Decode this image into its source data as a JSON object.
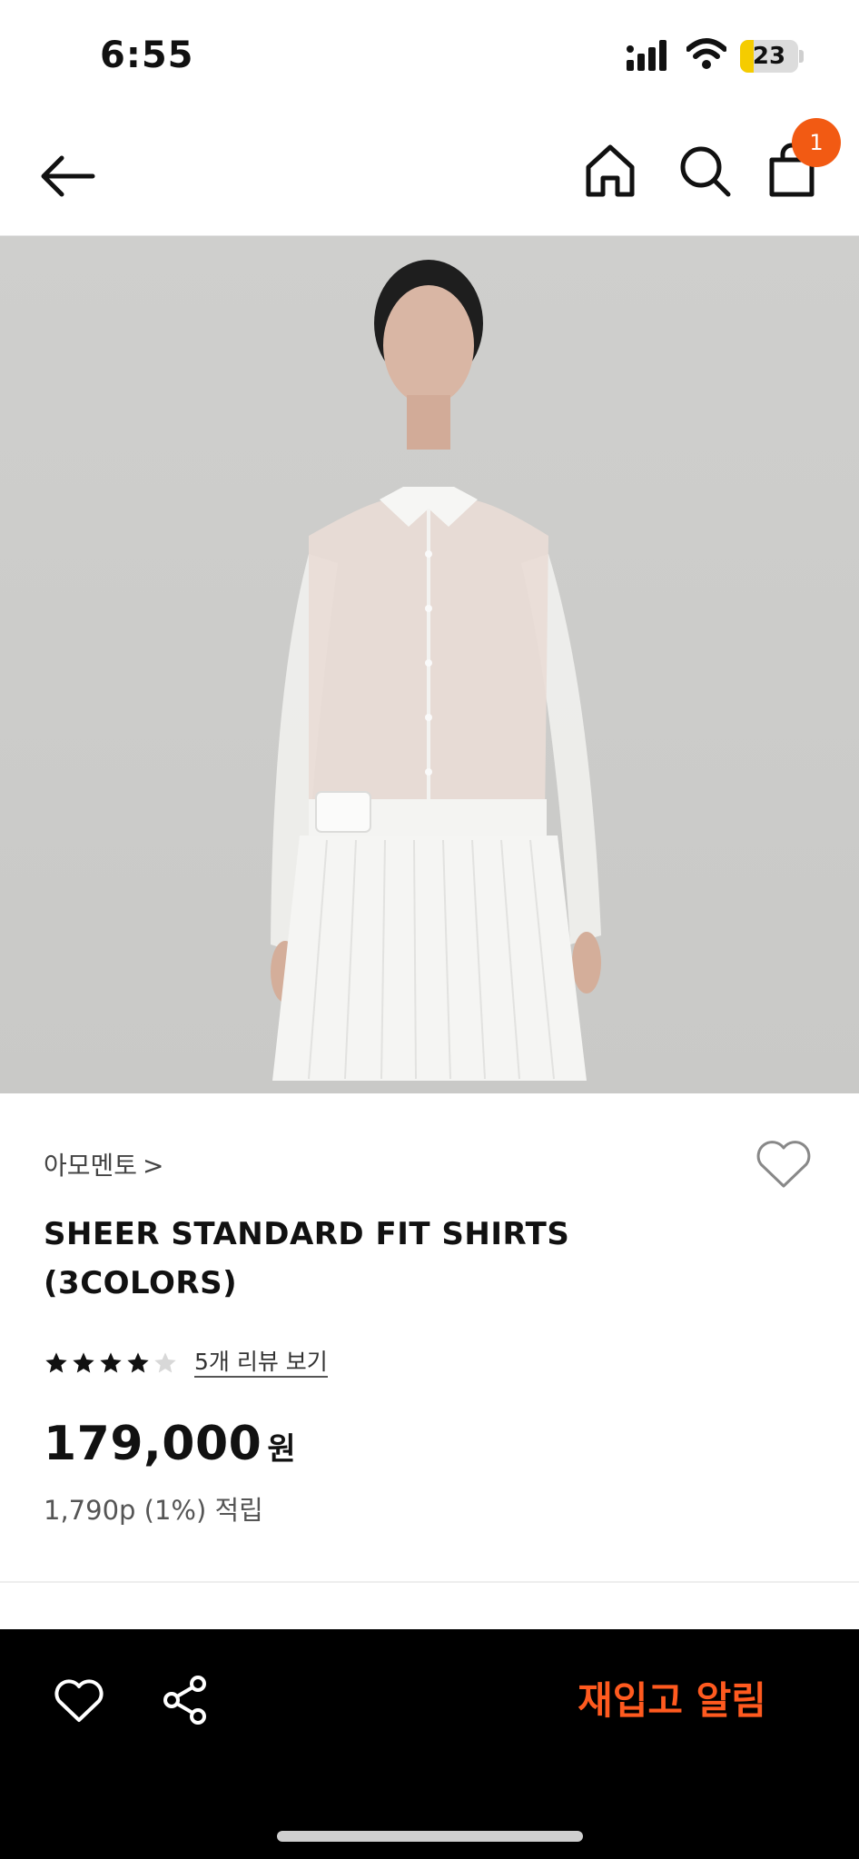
{
  "status_bar": {
    "time": "6:55",
    "battery_level": "23",
    "battery_fraction": 0.23,
    "icons": [
      "signal-icon",
      "wifi-icon",
      "battery-icon"
    ]
  },
  "nav": {
    "icons": [
      "back-arrow-icon",
      "home-icon",
      "search-icon",
      "shopping-bag-icon"
    ],
    "cart_count": "1"
  },
  "product": {
    "brand": "아모멘토",
    "brand_chevron": ">",
    "name_line1": "SHEER STANDARD FIT SHIRTS",
    "name_line2": "(3COLORS)",
    "rating": 4,
    "rating_max": 5,
    "review_link": "5개 리뷰 보기",
    "price": "179,000",
    "price_unit": "원",
    "points": "1,790p (1%) 적립"
  },
  "bottom_bar": {
    "restock_label": "재입고 알림",
    "icons": [
      "heart-icon",
      "share-icon"
    ]
  },
  "colors": {
    "accent": "#F25A13",
    "restock_text": "#FF5A1F",
    "bottom_bar_bg": "#000000",
    "image_bg": "#CDCDCB",
    "star_filled": "#111111",
    "star_empty": "#D8D8D8"
  }
}
